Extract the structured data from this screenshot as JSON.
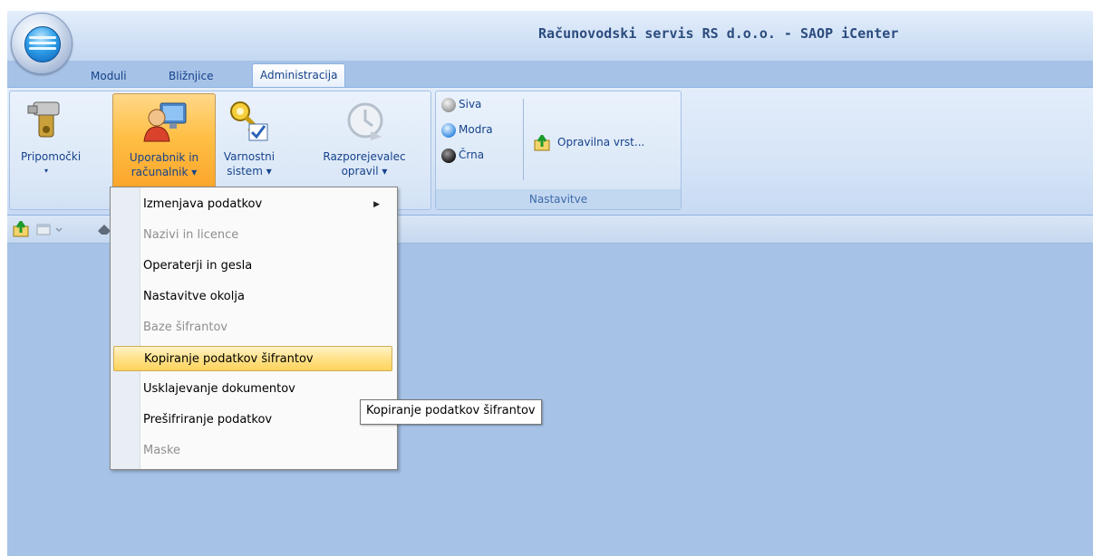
{
  "window": {
    "title": "Računovodski servis RS d.o.o. - SAOP iCenter"
  },
  "tabs": [
    {
      "label": "Moduli",
      "active": false
    },
    {
      "label": "Bližnjice",
      "active": false
    },
    {
      "label": "Administracija",
      "active": true
    }
  ],
  "ribbon": {
    "group1": {
      "buttons": [
        {
          "label1": "Pripomočki",
          "label2": "▾",
          "icon": "tools-icon",
          "state": "normal"
        },
        {
          "label1": "Uporabnik in",
          "label2": "računalnik ▾",
          "icon": "user-computer-icon",
          "state": "pressed"
        },
        {
          "label1": "Varnostni",
          "label2": "sistem ▾",
          "icon": "security-key-icon",
          "state": "normal"
        },
        {
          "label1": "Razporejevalec",
          "label2": "opravil ▾",
          "icon": "scheduler-clock-icon",
          "state": "disabled"
        }
      ]
    },
    "nastavitve": {
      "label": "Nastavitve",
      "styles": [
        {
          "label": "Siva",
          "color": "#9a9a9a"
        },
        {
          "label": "Modra",
          "color": "#3a8de0"
        },
        {
          "label": "Črna",
          "color": "#1a1a1a"
        }
      ],
      "opravilna": {
        "label": "Opravilna vrst...",
        "icon": "taskbar-up-icon"
      }
    }
  },
  "context_menu": {
    "items": [
      {
        "label": "Izmenjava podatkov",
        "disabled": false,
        "submenu": true,
        "submenu_arrow": "▶"
      },
      {
        "label": "Nazivi in licence",
        "disabled": true
      },
      {
        "label": "Operaterji in gesla",
        "disabled": false
      },
      {
        "label": "Nastavitve okolja",
        "disabled": false
      },
      {
        "label": "Baze šifrantov",
        "disabled": true
      },
      {
        "label": "Kopiranje podatkov šifrantov",
        "disabled": false,
        "highlighted": true
      },
      {
        "label": "Usklajevanje dokumentov",
        "disabled": false
      },
      {
        "label": "Prešifriranje podatkov",
        "disabled": false
      },
      {
        "label": "Maske",
        "disabled": true
      }
    ]
  },
  "tooltip": {
    "text": "Kopiranje podatkov šifrantov"
  }
}
